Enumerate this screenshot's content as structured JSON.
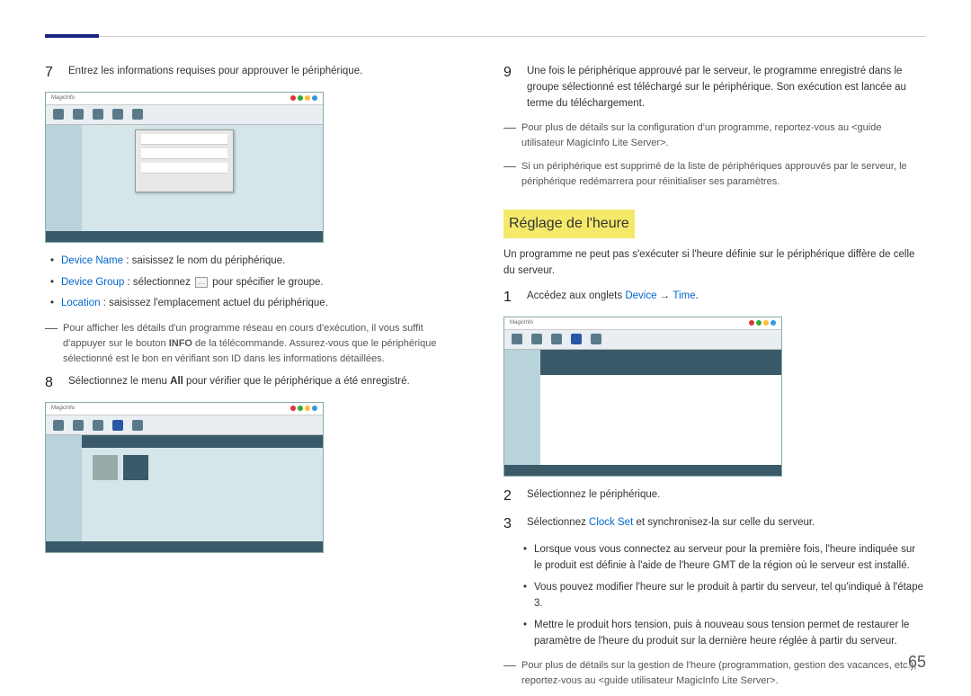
{
  "leftColumn": {
    "step7": {
      "num": "7",
      "text": "Entrez les informations requises pour approuver le périphérique."
    },
    "bullets": {
      "deviceName": {
        "label": "Device Name",
        "after": " : saisissez le nom du périphérique."
      },
      "deviceGroup": {
        "label": "Device Group",
        "before": " : sélectionnez ",
        "after": " pour spécifier le groupe."
      },
      "location": {
        "label": "Location",
        "after": " : saisissez l'emplacement actuel du périphérique."
      }
    },
    "note1": "Pour afficher les détails d'un programme réseau en cours d'exécution, il vous suffit d'appuyer sur le bouton INFO de la télécommande. Assurez-vous que le périphérique sélectionné est le bon en vérifiant son ID dans les informations détaillées.",
    "step8": {
      "num": "8",
      "before": "Sélectionnez le menu ",
      "all": "All",
      "after": " pour vérifier que le périphérique a été enregistré."
    }
  },
  "rightColumn": {
    "step9": {
      "num": "9",
      "text": "Une fois le périphérique approuvé par le serveur, le programme enregistré dans le groupe sélectionné est téléchargé sur le périphérique. Son exécution est lancée au terme du téléchargement."
    },
    "note2": "Pour plus de détails sur la configuration d'un programme, reportez-vous au <guide utilisateur MagicInfo Lite Server>.",
    "note3": "Si un périphérique est supprimé de la liste de périphériques approuvés par le serveur, le périphérique redémarrera pour réinitialiser ses paramètres.",
    "heading": "Réglage de l'heure",
    "intro": "Un programme ne peut pas s'exécuter si l'heure définie sur le périphérique diffère de celle du serveur.",
    "step1": {
      "num": "1",
      "before": "Accédez aux onglets ",
      "device": "Device",
      "arrow": " → ",
      "time": "Time",
      "after": "."
    },
    "step2": {
      "num": "2",
      "text": "Sélectionnez le périphérique."
    },
    "step3": {
      "num": "3",
      "before": "Sélectionnez ",
      "clockset": "Clock Set",
      "after": " et synchronisez-la sur celle du serveur."
    },
    "bullets2": {
      "b1": "Lorsque vous vous connectez au serveur pour la première fois, l'heure indiquée sur le produit est définie à l'aide de l'heure GMT de la région où le serveur est installé.",
      "b2": "Vous pouvez modifier l'heure sur le produit à partir du serveur, tel qu'indiqué à l'étape 3.",
      "b3": "Mettre le produit hors tension, puis à nouveau sous tension permet de restaurer le paramètre de l'heure du produit sur la dernière heure réglée à partir du serveur."
    },
    "note4": "Pour plus de détails sur la gestion de l'heure (programmation, gestion des vacances, etc.), reportez-vous au <guide utilisateur MagicInfo Lite Server>."
  },
  "pageNumber": "65",
  "infoBold": "INFO",
  "btnDots": "…"
}
